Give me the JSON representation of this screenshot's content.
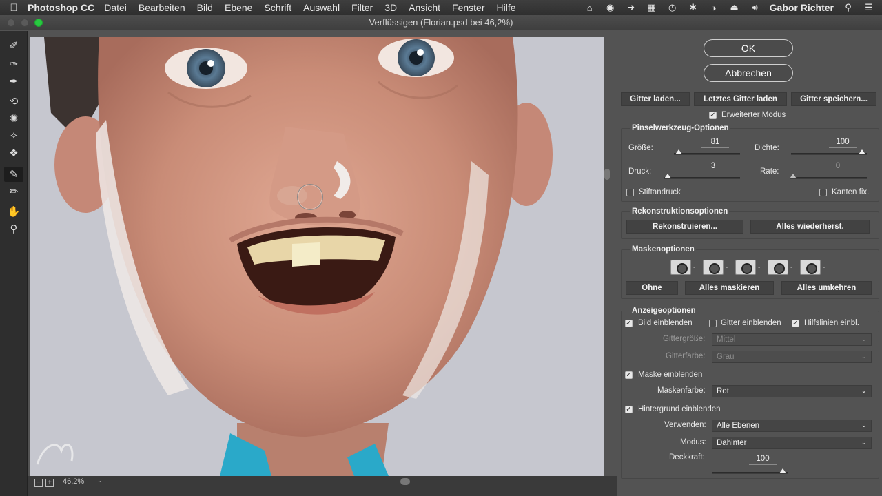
{
  "menubar": {
    "app_name": "Photoshop CC",
    "items": [
      "Datei",
      "Bearbeiten",
      "Bild",
      "Ebene",
      "Schrift",
      "Auswahl",
      "Filter",
      "3D",
      "Ansicht",
      "Fenster",
      "Hilfe"
    ],
    "user": "Gabor Richter",
    "status_icons": [
      "home-icon",
      "camera-icon",
      "forward-icon",
      "battery-icon",
      "clock-icon",
      "bluetooth-icon",
      "wifi-icon",
      "eject-icon",
      "volume-icon"
    ]
  },
  "window": {
    "title": "Verflüssigen (Florian.psd bei 46,2%)"
  },
  "toolbar": {
    "tools": [
      "forward-warp-icon",
      "reconstruct-icon",
      "smooth-icon",
      "twirl-icon",
      "pucker-icon",
      "bloat-icon",
      "push-left-icon",
      "freeze-mask-icon",
      "thaw-mask-icon",
      "hand-icon",
      "zoom-icon"
    ],
    "active_tool": "freeze-mask-icon"
  },
  "statusbar": {
    "zoom": "46,2%"
  },
  "panel": {
    "ok": "OK",
    "cancel": "Abbrechen",
    "mesh_load": "Gitter laden...",
    "mesh_load_last": "Letztes Gitter laden",
    "mesh_save": "Gitter speichern...",
    "advanced_mode": "Erweiterter Modus",
    "brush": {
      "title": "Pinselwerkzeug-Optionen",
      "size_label": "Größe:",
      "size_value": "81",
      "density_label": "Dichte:",
      "density_value": "100",
      "pressure_label": "Druck:",
      "pressure_value": "3",
      "rate_label": "Rate:",
      "rate_value": "0",
      "stylus": "Stiftandruck",
      "pin_edges": "Kanten fix."
    },
    "reconstruct": {
      "title": "Rekonstruktionsoptionen",
      "reconstruct_btn": "Rekonstruieren...",
      "restore_all": "Alles wiederherst."
    },
    "mask": {
      "title": "Maskenoptionen",
      "none": "Ohne",
      "mask_all": "Alles maskieren",
      "invert_all": "Alles umkehren"
    },
    "view": {
      "title": "Anzeigeoptionen",
      "show_image": "Bild einblenden",
      "show_mesh": "Gitter einblenden",
      "show_guides": "Hilfslinien einbl.",
      "mesh_size_label": "Gittergröße:",
      "mesh_size_value": "Mittel",
      "mesh_color_label": "Gitterfarbe:",
      "mesh_color_value": "Grau",
      "show_mask": "Maske einblenden",
      "mask_color_label": "Maskenfarbe:",
      "mask_color_value": "Rot",
      "show_backdrop": "Hintergrund einblenden",
      "use_label": "Verwenden:",
      "use_value": "Alle Ebenen",
      "mode_label": "Modus:",
      "mode_value": "Dahinter",
      "opacity_label": "Deckkraft:",
      "opacity_value": "100"
    }
  },
  "colors": {
    "panel_bg": "#535353",
    "skin": "#d49a86",
    "shirt": "#2aa9c9"
  }
}
